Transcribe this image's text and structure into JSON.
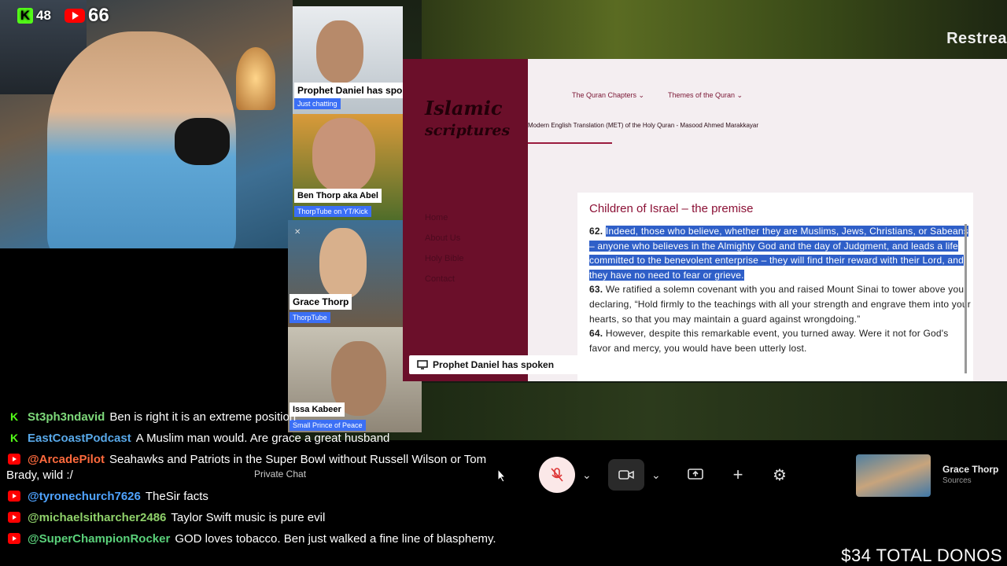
{
  "overlay": {
    "kick_count": "48",
    "youtube_count": "66",
    "donations": "$34 TOTAL DONOS"
  },
  "restream": {
    "label": "Restrea"
  },
  "participants": [
    {
      "name": "Prophet Daniel has spok",
      "tag": "Just chatting"
    },
    {
      "name": "Ben Thorp aka Abel",
      "tag": "ThorpTube on YT/Kick"
    },
    {
      "name": "Grace Thorp",
      "tag": "ThorpTube"
    },
    {
      "name": "Issa Kabeer",
      "tag": "Small Prince of Peace"
    }
  ],
  "website": {
    "logo": [
      "Islamic",
      "scriptures"
    ],
    "sidebar": [
      "Home",
      "About Us",
      "Holy Bible",
      "Contact"
    ],
    "nav": [
      "The Quran Chapters ⌄",
      "Themes of the Quran ⌄"
    ],
    "subtitle": "Modern English Translation (MET) of the Holy Quran - Masood Ahmed Marakkayar",
    "card_title": "Children of Israel – the premise",
    "verses": [
      {
        "num": "62.",
        "text": "Indeed, those who believe, whether they are Muslims, Jews, Christians, or Sabeans – anyone who believes in the Almighty God and the day of Judgment, and leads a life committed to the benevolent enterprise – they will find their reward with their Lord, and they have no need to fear or grieve."
      },
      {
        "num": "63.",
        "text": "We ratified a solemn covenant with you and raised Mount Sinai to tower above you, declaring, “Hold firmly to the teachings with all your strength and engrave them into your hearts, so that you may maintain a guard against wrongdoing.”"
      },
      {
        "num": "64.",
        "text": "However, despite this remarkable event, you turned away. Were it not for God's favor and mercy, you would have been utterly lost."
      }
    ]
  },
  "speaker_label": "Prophet Daniel has spoken",
  "chat": [
    {
      "platform": "kick",
      "user": "St3ph3ndavid",
      "user_color": "#7dd87a",
      "text": "Ben is right it is an extreme position"
    },
    {
      "platform": "kick",
      "user": "EastCoastPodcast",
      "user_color": "#58a8e8",
      "text": "A Muslim man would. Are grace a great husband"
    },
    {
      "platform": "youtube",
      "user": "@ArcadePilot",
      "user_color": "#ff6a3d",
      "text": "Seahawks and Patriots in the Super Bowl without Russell Wilson or Tom Brady, wild :/"
    },
    {
      "platform": "youtube",
      "user": "@tyronechurch7626",
      "user_color": "#4fa3ff",
      "text": "TheSir facts"
    },
    {
      "platform": "youtube",
      "user": "@michaelsitharcher2486",
      "user_color": "#8fd16a",
      "text": "Taylor Swift music is pure evil"
    },
    {
      "platform": "youtube",
      "user": "@SuperChampionRocker",
      "user_color": "#5ad17a",
      "text": "GOD loves tobacco. Ben just walked a fine line of blasphemy."
    }
  ],
  "call": {
    "private_chat": "Private Chat",
    "self_name": "Grace Thorp",
    "self_sub": "Sources"
  },
  "colors": {
    "site_sidebar": "#6b0f2a",
    "highlight": "#2f5fc8",
    "kick": "#53fc18",
    "youtube": "#ff0000"
  }
}
